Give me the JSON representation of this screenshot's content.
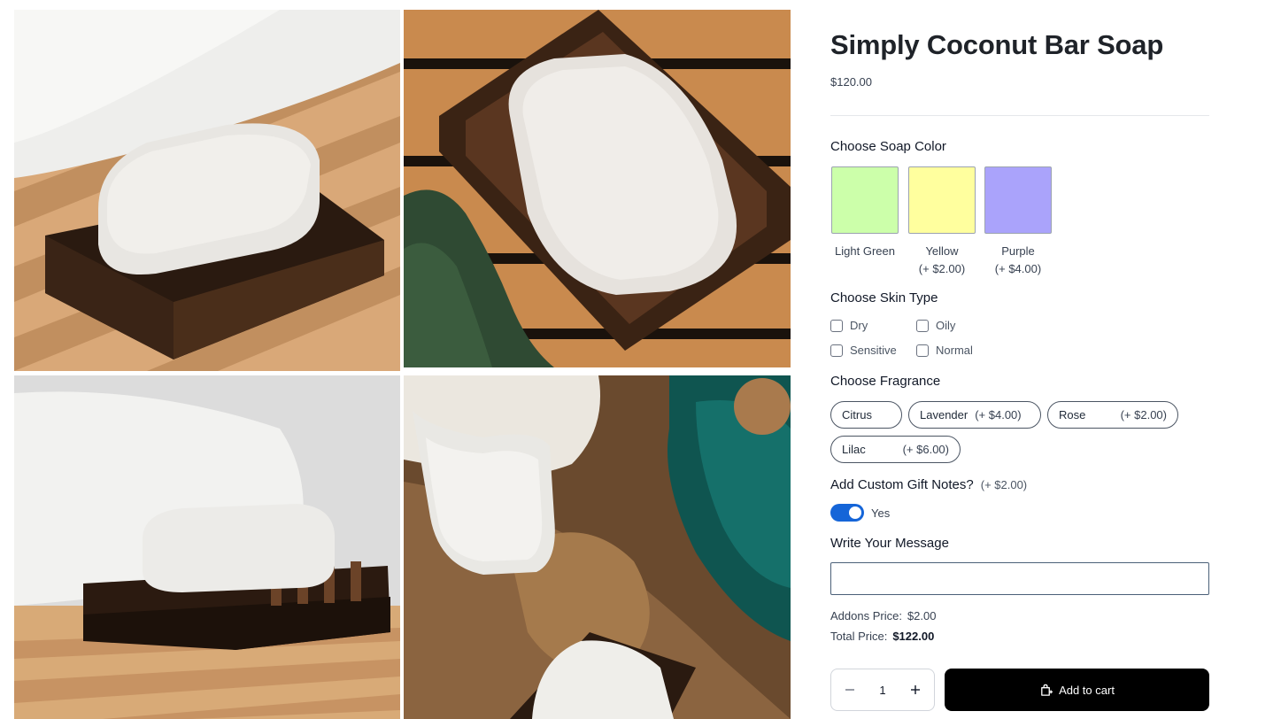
{
  "gallery": {
    "images": [
      {
        "alt": "White soap bar on dark wooden dish with towel"
      },
      {
        "alt": "Soap bar on slatted wooden dish from above"
      },
      {
        "alt": "Soap bar on wooden dish on bath bench"
      },
      {
        "alt": "Soap bars with loofah, dried leaves and teal bottle"
      }
    ]
  },
  "product": {
    "title": "Simply Coconut Bar Soap",
    "price": "$120.00"
  },
  "soap_color": {
    "label": "Choose Soap Color",
    "options": [
      {
        "name": "Light Green",
        "extra": "",
        "color": "#ccffaa"
      },
      {
        "name": "Yellow",
        "extra": "(+ $2.00)",
        "color": "#ffff9e"
      },
      {
        "name": "Purple",
        "extra": "(+ $4.00)",
        "color": "#aaa3fb"
      }
    ]
  },
  "skin_type": {
    "label": "Choose Skin Type",
    "options": [
      "Dry",
      "Oily",
      "Sensitive",
      "Normal"
    ]
  },
  "fragrance": {
    "label": "Choose Fragrance",
    "options": [
      {
        "name": "Citrus",
        "extra": ""
      },
      {
        "name": "Lavender",
        "extra": "(+ $4.00)"
      },
      {
        "name": "Rose",
        "extra": "(+ $2.00)"
      },
      {
        "name": "Lilac",
        "extra": "(+ $6.00)"
      }
    ]
  },
  "gift_notes": {
    "label": "Add Custom Gift Notes?",
    "extra": "(+ $2.00)",
    "toggle_label": "Yes",
    "enabled": true
  },
  "message": {
    "label": "Write Your Message",
    "value": ""
  },
  "summary": {
    "addons_label": "Addons Price:",
    "addons_value": "$2.00",
    "total_label": "Total Price:",
    "total_value": "$122.00"
  },
  "cart": {
    "quantity": "1",
    "add_label": "Add to cart"
  },
  "colors": {
    "accent": "#1565d8",
    "button_bg": "#000000"
  },
  "icons": [
    "minus-icon",
    "plus-icon",
    "cart-icon"
  ]
}
